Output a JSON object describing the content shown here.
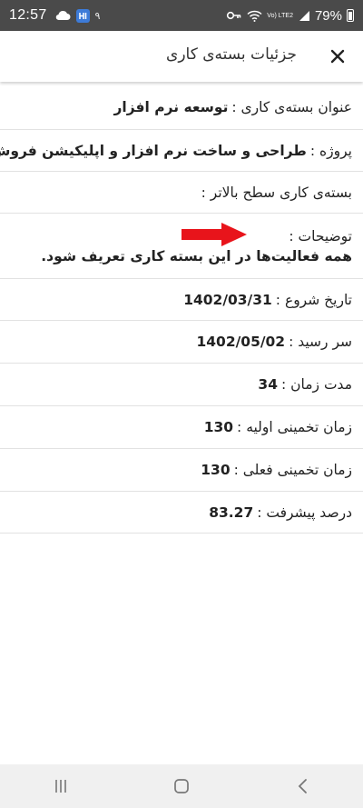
{
  "status_bar": {
    "time": "12:57",
    "notification_count": "۹",
    "lte_label": "Vo) LTE2",
    "battery_percent": "79%"
  },
  "header": {
    "title": "جزئیات بسته‌ی کاری",
    "close_icon": "close-icon"
  },
  "details": {
    "work_package_title": {
      "label": "عنوان بسته‌ی کاری :",
      "value": "توسعه نرم افزار"
    },
    "project": {
      "label": "پروژه :",
      "value": "طراحی و ساخت نرم افزار و اپلیکیشن فروش"
    },
    "parent_package": {
      "label": "بسته‌ی کاری سطح بالاتر :",
      "value": ""
    },
    "description": {
      "label": "توضیحات :",
      "value": "همه فعالیت‌ها در این بسته کاری تعریف شود."
    },
    "start_date": {
      "label": "تاریخ شروع :",
      "value": "1402/03/31"
    },
    "due_date": {
      "label": "سر رسید :",
      "value": "1402/05/02"
    },
    "duration": {
      "label": "مدت زمان :",
      "value": "34"
    },
    "initial_estimate": {
      "label": "زمان تخمینی اولیه :",
      "value": "130"
    },
    "current_estimate": {
      "label": "زمان تخمینی فعلی :",
      "value": "130"
    },
    "progress_percent": {
      "label": "درصد پیشرفت :",
      "value": "83.27"
    }
  },
  "annotation": {
    "arrow_color": "#e8141b",
    "icon": "arrow-right-icon"
  },
  "nav_bar": {
    "recents_icon": "recents-icon",
    "home_icon": "home-icon",
    "back_icon": "back-icon"
  }
}
